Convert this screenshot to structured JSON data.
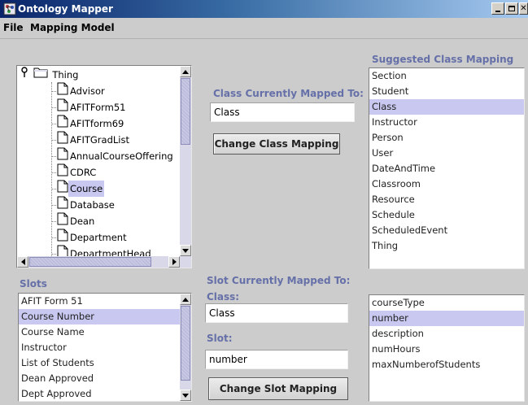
{
  "window": {
    "title": "Ontology Mapper"
  },
  "menu": {
    "items": [
      "File",
      "Mapping Model"
    ]
  },
  "tree": {
    "root_label": "Thing",
    "items": [
      {
        "label": "Advisor"
      },
      {
        "label": "AFITForm51"
      },
      {
        "label": "AFITform69"
      },
      {
        "label": "AFITGradList"
      },
      {
        "label": "AnnualCourseOffering"
      },
      {
        "label": "CDRC"
      },
      {
        "label": "Course",
        "selected": true
      },
      {
        "label": "Database"
      },
      {
        "label": "Dean"
      },
      {
        "label": "Department"
      },
      {
        "label": "DepartmentHead"
      }
    ]
  },
  "class_mapping": {
    "heading": "Class Currently Mapped To:",
    "value": "Class",
    "button": "Change Class Mapping"
  },
  "suggested_class": {
    "heading": "Suggested Class Mapping",
    "items": [
      {
        "label": "Section"
      },
      {
        "label": "Student"
      },
      {
        "label": "Class",
        "selected": true
      },
      {
        "label": "Instructor"
      },
      {
        "label": "Person"
      },
      {
        "label": "User"
      },
      {
        "label": "DateAndTime"
      },
      {
        "label": "Classroom"
      },
      {
        "label": "Resource"
      },
      {
        "label": "Schedule"
      },
      {
        "label": "ScheduledEvent"
      },
      {
        "label": "Thing"
      }
    ]
  },
  "slots": {
    "heading": "Slots",
    "items": [
      {
        "label": "AFIT Form 51"
      },
      {
        "label": "Course Number",
        "selected": true
      },
      {
        "label": "Course Name"
      },
      {
        "label": "Instructor"
      },
      {
        "label": "List of Students"
      },
      {
        "label": "Dean Approved"
      },
      {
        "label": "Dept Approved"
      }
    ]
  },
  "slot_mapping": {
    "heading": "Slot Currently Mapped To:",
    "class_label": "Class:",
    "class_value": "Class",
    "slot_label": "Slot:",
    "slot_value": "number",
    "button": "Change Slot Mapping"
  },
  "suggested_slot": {
    "items": [
      {
        "label": "courseType"
      },
      {
        "label": "number",
        "selected": true
      },
      {
        "label": "description"
      },
      {
        "label": "numHours"
      },
      {
        "label": "maxNumberofStudents"
      }
    ]
  },
  "colors": {
    "heading": "#6670a8",
    "selection": "#c8c8f0",
    "background": "#cccccc"
  }
}
